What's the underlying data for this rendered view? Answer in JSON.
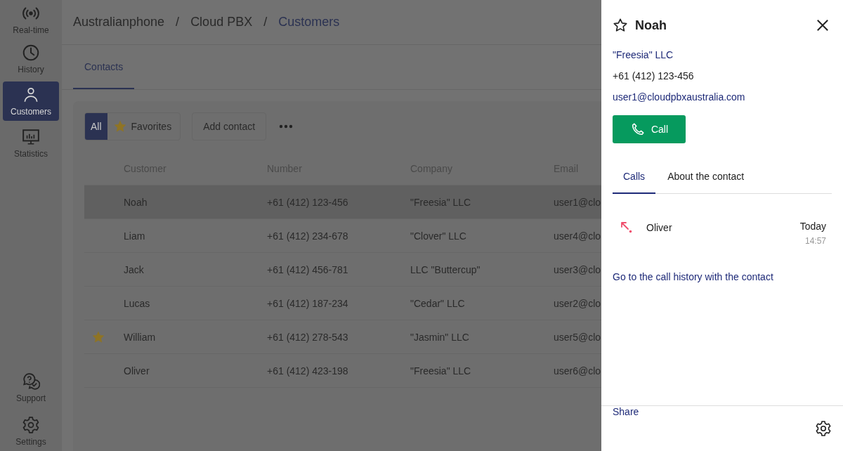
{
  "nav": {
    "items": [
      {
        "label": "Real-time",
        "kind": "realtime",
        "selected": false
      },
      {
        "label": "History",
        "kind": "history",
        "selected": false
      },
      {
        "label": "Customers",
        "kind": "customers",
        "selected": true
      },
      {
        "label": "Statistics",
        "kind": "statistics",
        "selected": false
      }
    ],
    "bottom_items": [
      {
        "label": "Support",
        "kind": "support",
        "selected": false
      },
      {
        "label": "Settings",
        "kind": "settings",
        "selected": false
      }
    ]
  },
  "breadcrumb": [
    {
      "text": "Australianphone",
      "kind": "crumb"
    },
    {
      "text": "/",
      "kind": "separator"
    },
    {
      "text": "Cloud PBX",
      "kind": "crumb"
    },
    {
      "text": "/",
      "kind": "separator"
    },
    {
      "text": "Customers",
      "kind": "current"
    }
  ],
  "tabs": [
    {
      "label": "Contacts",
      "selected": true
    }
  ],
  "filters": [
    {
      "label": "All",
      "selected": true,
      "kind": "plain"
    },
    {
      "label": "Favorites",
      "selected": false,
      "kind": "star"
    }
  ],
  "add_contact": "Add contact",
  "table": {
    "columns": [
      "Customer",
      "Number",
      "Company",
      "Email"
    ],
    "rows": [
      {
        "favorite": false,
        "selected": true,
        "customer": "Noah",
        "number": "+61 (412) 123-456",
        "company": "\"Freesia\" LLC",
        "email": "user1@clo"
      },
      {
        "favorite": false,
        "selected": false,
        "customer": "Liam",
        "number": "+61 (412) 234-678",
        "company": "\"Clover\" LLC",
        "email": "user4@clo"
      },
      {
        "favorite": false,
        "selected": false,
        "customer": "Jack",
        "number": "+61 (412) 456-781",
        "company": "LLC \"Buttercup\"",
        "email": "user3@clo"
      },
      {
        "favorite": false,
        "selected": false,
        "customer": "Lucas",
        "number": "+61 (412) 187-234",
        "company": "\"Cedar\" LLC",
        "email": "user2@clo"
      },
      {
        "favorite": true,
        "selected": false,
        "customer": "William",
        "number": "+61 (412) 278-543",
        "company": "\"Jasmin\" LLC",
        "email": "user5@clo"
      },
      {
        "favorite": false,
        "selected": false,
        "customer": "Oliver",
        "number": "+61 (412) 423-198",
        "company": "\"Freesia\" LLC",
        "email": "user6@clo"
      }
    ]
  },
  "panel": {
    "name": "Noah",
    "favorite": false,
    "company": "\"Freesia\" LLC",
    "phone": "+61 (412) 123-456",
    "email": "user1@cloudpbxaustralia.com",
    "call_button": "Call",
    "tabs": [
      {
        "label": "Calls",
        "selected": true
      },
      {
        "label": "About the contact",
        "selected": false
      }
    ],
    "calls": [
      {
        "name": "Oliver",
        "missed": true,
        "day": "Today",
        "time": "14:57"
      }
    ],
    "history_link": "Go to the call history with the contact",
    "share": "Share"
  }
}
